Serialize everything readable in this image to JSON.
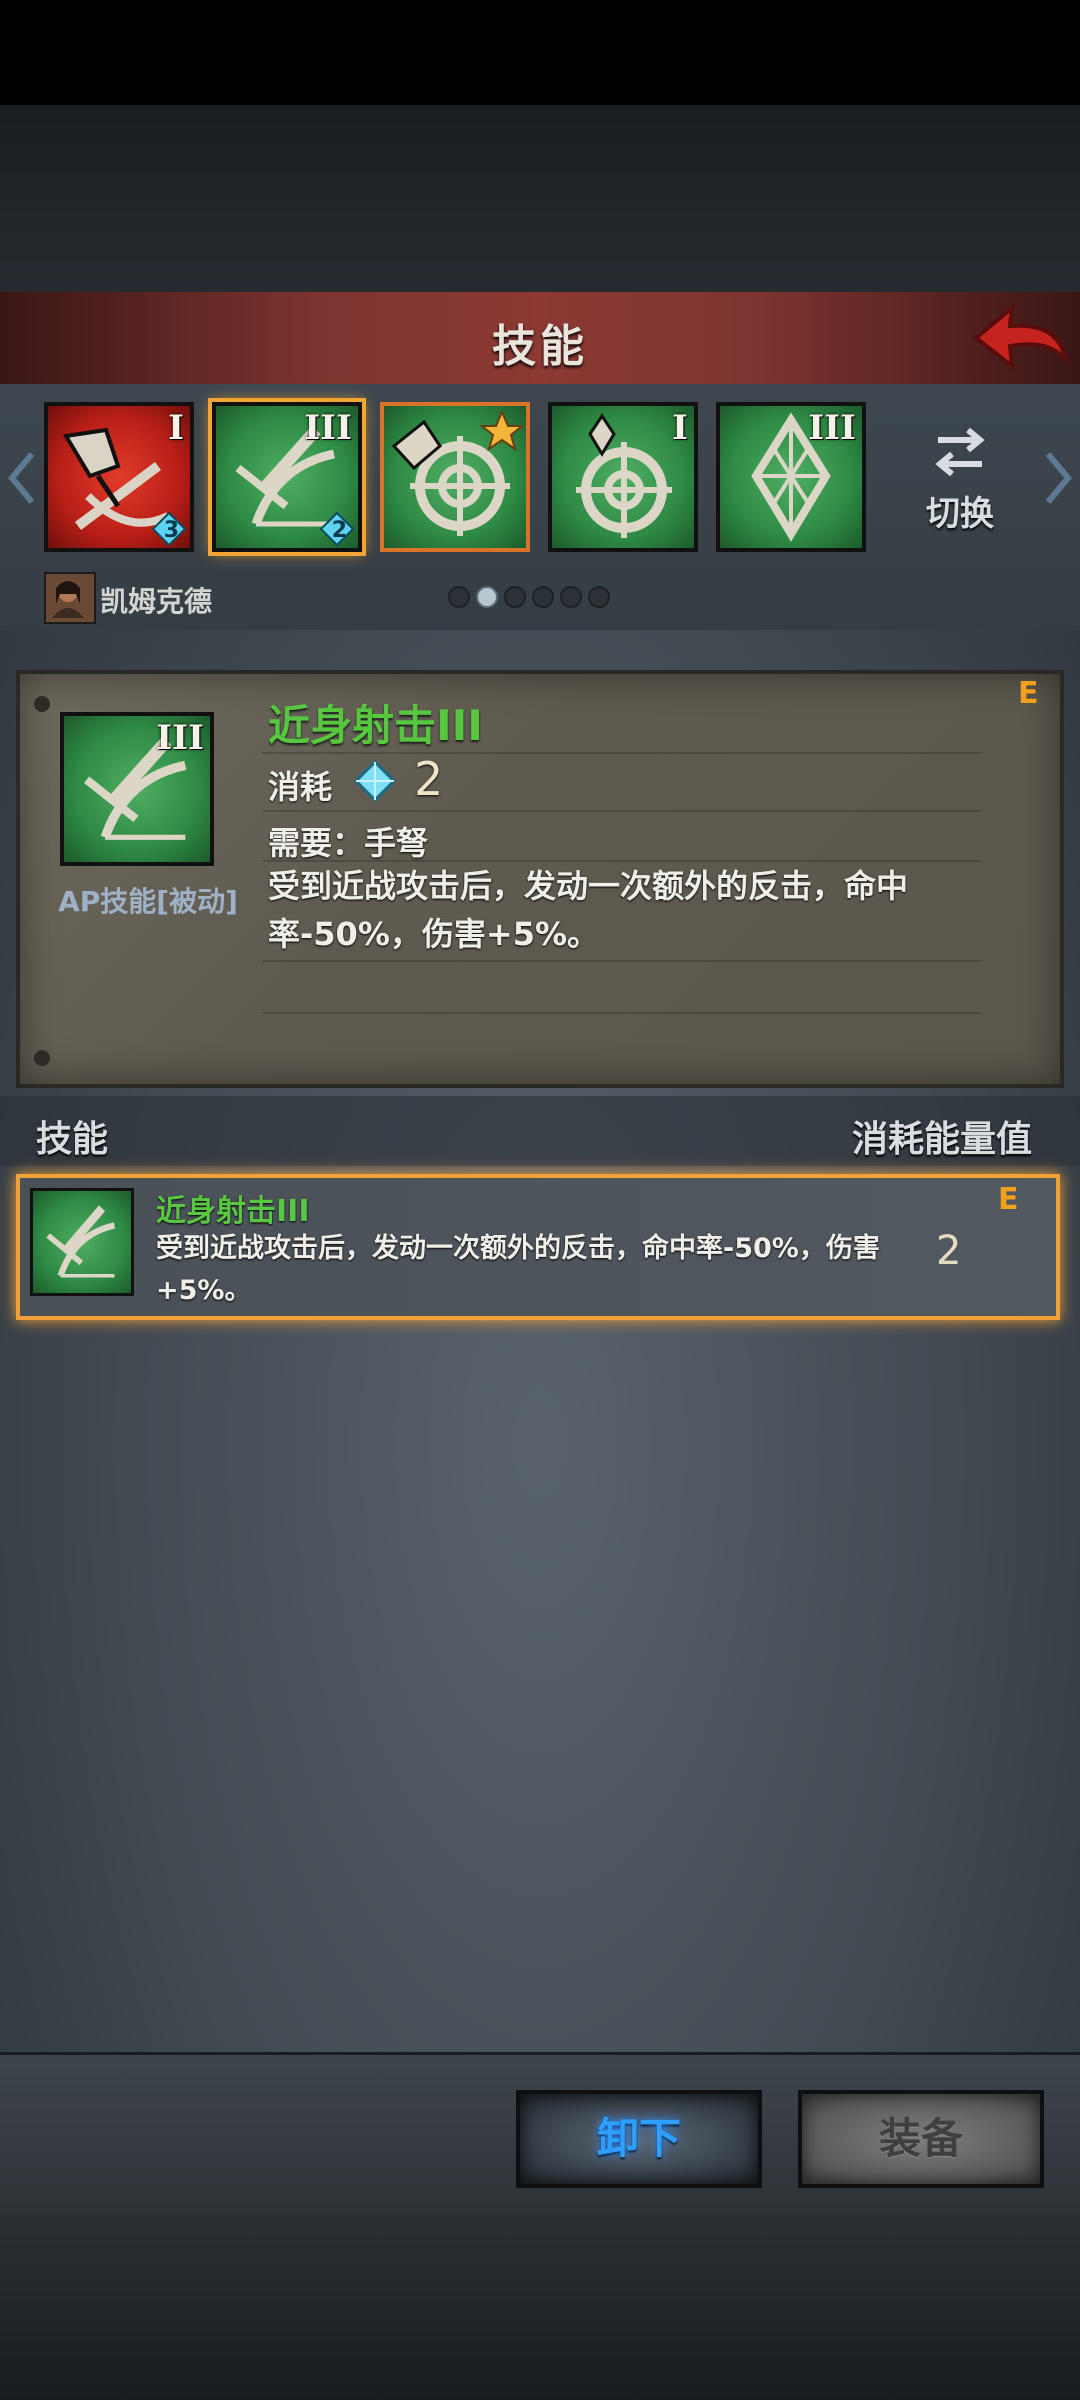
{
  "header": {
    "title": "技能"
  },
  "skill_slots": [
    {
      "roman": "I",
      "gem": "3",
      "color": "red",
      "icon": "crossbow-crossed-icon"
    },
    {
      "roman": "III",
      "gem": "2",
      "color": "green",
      "icon": "crossbow-crossed-icon",
      "selected": true
    },
    {
      "roman": "",
      "gem": "",
      "color": "green",
      "icon": "target-star-icon",
      "starred": true
    },
    {
      "roman": "I",
      "gem": "",
      "color": "green",
      "icon": "target-gem-icon"
    },
    {
      "roman": "III",
      "gem": "",
      "color": "green",
      "icon": "diamond-gem-icon"
    }
  ],
  "switch": {
    "label": "切换"
  },
  "character": {
    "name": "凯姆克德"
  },
  "pager": {
    "total": 6,
    "current": 2
  },
  "detail": {
    "grade": "E",
    "name": "近身射击III",
    "roman": "III",
    "cost_label": "消耗",
    "cost_value": "2",
    "require": "需要：手弩",
    "desc_line1": "受到近战攻击后，发动一次额外的反击，命中",
    "desc_line2": "率-50%，伤害+5%。",
    "type": "AP技能[被动]"
  },
  "list": {
    "col_skill": "技能",
    "col_cost": "消耗能量值",
    "items": [
      {
        "name": "近身射击III",
        "desc_line1": "受到近战攻击后，发动一次额外的反击，命中率-50%，伤害",
        "desc_line2": "+5%。",
        "cost": "2",
        "grade": "E"
      }
    ]
  },
  "buttons": {
    "unequip": "卸下",
    "equip": "装备"
  }
}
